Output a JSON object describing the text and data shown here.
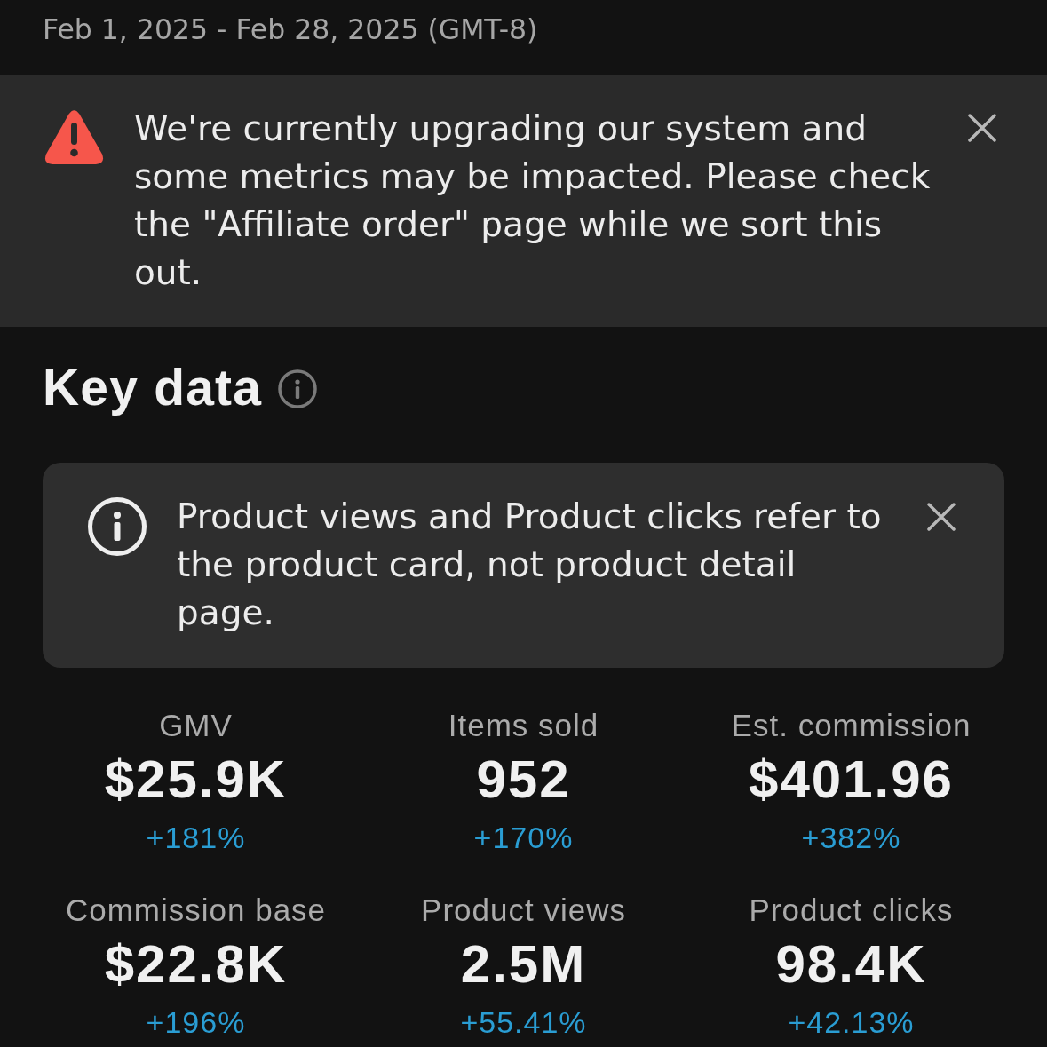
{
  "date_range": "Feb 1, 2025 - Feb 28, 2025 (GMT-8)",
  "alert_banner": {
    "kind": "warning",
    "message": "We're currently upgrading our system and some metrics may be impacted. Please check the \"Affiliate order\" page while we sort this out."
  },
  "key_data": {
    "title": "Key data",
    "notice": {
      "kind": "info",
      "message": "Product views and Product clicks refer to the product card, not product detail page."
    },
    "metrics": [
      {
        "label": "GMV",
        "value": "$25.9K",
        "change": "+181%",
        "positive": true
      },
      {
        "label": "Items sold",
        "value": "952",
        "change": "+170%",
        "positive": true
      },
      {
        "label": "Est. commission",
        "value": "$401.96",
        "change": "+382%",
        "positive": true
      },
      {
        "label": "Commission base",
        "value": "$22.8K",
        "change": "+196%",
        "positive": true
      },
      {
        "label": "Product views",
        "value": "2.5M",
        "change": "+55.41%",
        "positive": true
      },
      {
        "label": "Product clicks",
        "value": "98.4K",
        "change": "+42.13%",
        "positive": true
      }
    ]
  }
}
